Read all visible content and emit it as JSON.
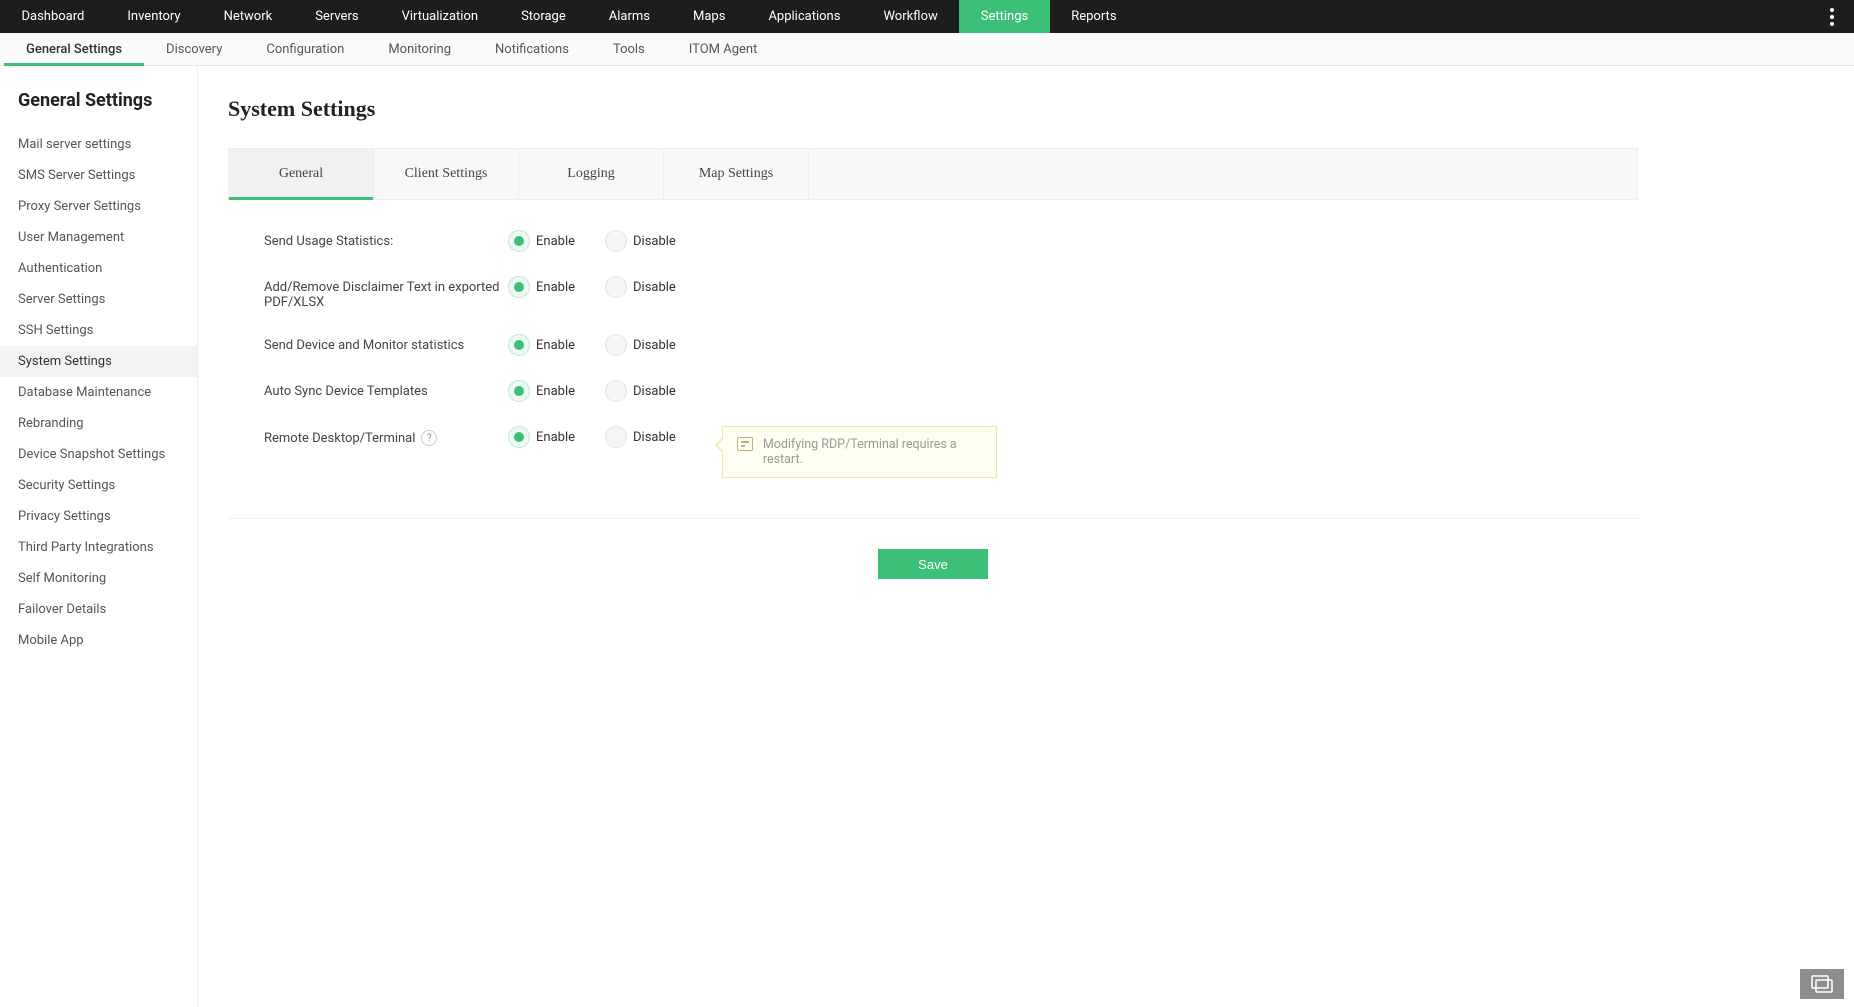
{
  "topnav": {
    "items": [
      {
        "label": "Dashboard"
      },
      {
        "label": "Inventory"
      },
      {
        "label": "Network"
      },
      {
        "label": "Servers"
      },
      {
        "label": "Virtualization"
      },
      {
        "label": "Storage"
      },
      {
        "label": "Alarms"
      },
      {
        "label": "Maps"
      },
      {
        "label": "Applications"
      },
      {
        "label": "Workflow"
      },
      {
        "label": "Settings",
        "active": true
      },
      {
        "label": "Reports"
      }
    ]
  },
  "subnav": {
    "items": [
      {
        "label": "General Settings",
        "active": true
      },
      {
        "label": "Discovery"
      },
      {
        "label": "Configuration"
      },
      {
        "label": "Monitoring"
      },
      {
        "label": "Notifications"
      },
      {
        "label": "Tools"
      },
      {
        "label": "ITOM Agent"
      }
    ]
  },
  "sidebar": {
    "heading": "General Settings",
    "items": [
      {
        "label": "Mail server settings"
      },
      {
        "label": "SMS Server Settings"
      },
      {
        "label": "Proxy Server Settings"
      },
      {
        "label": "User Management"
      },
      {
        "label": "Authentication"
      },
      {
        "label": "Server Settings"
      },
      {
        "label": "SSH Settings"
      },
      {
        "label": "System Settings",
        "active": true
      },
      {
        "label": "Database Maintenance"
      },
      {
        "label": "Rebranding"
      },
      {
        "label": "Device Snapshot Settings"
      },
      {
        "label": "Security Settings"
      },
      {
        "label": "Privacy Settings"
      },
      {
        "label": "Third Party Integrations"
      },
      {
        "label": "Self Monitoring"
      },
      {
        "label": "Failover Details"
      },
      {
        "label": "Mobile App"
      }
    ]
  },
  "main": {
    "title": "System Settings",
    "tabs": [
      {
        "label": "General",
        "active": true
      },
      {
        "label": "Client Settings"
      },
      {
        "label": "Logging"
      },
      {
        "label": "Map Settings"
      }
    ],
    "options": {
      "enable": "Enable",
      "disable": "Disable"
    },
    "settings": [
      {
        "label": "Send Usage Statistics:",
        "value": "enable"
      },
      {
        "label": "Add/Remove Disclaimer Text in exported PDF/XLSX",
        "value": "enable"
      },
      {
        "label": "Send Device and Monitor statistics",
        "value": "enable"
      },
      {
        "label": "Auto Sync Device Templates",
        "value": "enable"
      },
      {
        "label": "Remote Desktop/Terminal",
        "value": "enable",
        "help": true,
        "callout": "Modifying RDP/Terminal requires a restart."
      }
    ],
    "help_glyph": "?",
    "save_label": "Save"
  }
}
